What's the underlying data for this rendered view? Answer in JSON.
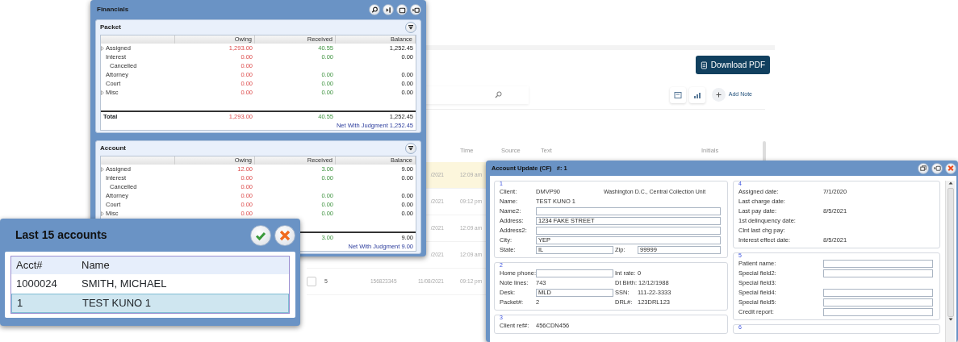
{
  "background_app": {
    "download_button": "Download PDF",
    "add_note_link": "Add Note",
    "columns": [
      "Time",
      "Source",
      "Text",
      "Initials"
    ],
    "rows": [
      {
        "selected": true,
        "date": "/2021",
        "time": "12:09 am"
      },
      {
        "selected": false,
        "date": "/2021",
        "time": "09:12 pm"
      },
      {
        "selected": false,
        "date": "/2021",
        "time": "12:09 am"
      },
      {
        "selected": false,
        "date": "/2021",
        "time": "12:09 am"
      },
      {
        "selected": false,
        "checked": false,
        "number": "5",
        "account": "156823345",
        "date": "11/08/2021",
        "time": "09:12 pm"
      }
    ]
  },
  "financials": {
    "title": "Financials",
    "panels": [
      {
        "title": "Packet",
        "columns": [
          "Owing",
          "Received",
          "Balance"
        ],
        "rows": [
          {
            "label": "Assigned",
            "expandable": true,
            "owing": "1,293.00",
            "received": "40.55",
            "balance": "1,252.45"
          },
          {
            "label": "Interest",
            "expandable": false,
            "owing": "0.00",
            "received": "0.00",
            "balance": "0.00",
            "children": [
              {
                "label": "Cancelled",
                "expandable": false,
                "owing": "0.00"
              }
            ]
          },
          {
            "label": "Attorney",
            "expandable": false,
            "owing": "0.00",
            "received": "0.00",
            "balance": "0.00"
          },
          {
            "label": "Court",
            "expandable": false,
            "owing": "0.00",
            "received": "0.00",
            "balance": "0.00"
          },
          {
            "label": "Misc",
            "expandable": true,
            "owing": "0.00",
            "received": "0.00",
            "balance": "0.00"
          }
        ],
        "total": {
          "label": "Total",
          "owing": "1,293.00",
          "received": "40.55",
          "balance": "1,252.45"
        },
        "net": "Net With Judgment 1,252.45"
      },
      {
        "title": "Account",
        "columns": [
          "Owing",
          "Received",
          "Balance"
        ],
        "rows": [
          {
            "label": "Assigned",
            "expandable": true,
            "owing": "12.00",
            "received": "3.00",
            "balance": "9.00"
          },
          {
            "label": "Interest",
            "expandable": false,
            "owing": "0.00",
            "received": "0.00",
            "balance": "0.00",
            "children": [
              {
                "label": "Cancelled",
                "expandable": false,
                "owing": "0.00"
              }
            ]
          },
          {
            "label": "Attorney",
            "expandable": false,
            "owing": "0.00",
            "received": "0.00",
            "balance": "0.00"
          },
          {
            "label": "Court",
            "expandable": false,
            "owing": "0.00",
            "received": "0.00",
            "balance": "0.00"
          },
          {
            "label": "Misc",
            "expandable": true,
            "owing": "0.00",
            "received": "0.00",
            "balance": "0.00"
          }
        ],
        "total": {
          "received": "3.00",
          "balance": "9.00"
        },
        "net": "Net With Judgment 9.00"
      }
    ]
  },
  "last_accounts": {
    "title": "Last 15 accounts",
    "columns": [
      "Acct#",
      "Name"
    ],
    "rows": [
      {
        "acct": "1000024",
        "name": "SMITH, MICHAEL",
        "selected": false
      },
      {
        "acct": "1",
        "name": "TEST KUNO 1",
        "selected": true
      }
    ]
  },
  "account_update": {
    "title": "Account Update (CF)   #: 1",
    "left_groups": [
      {
        "legend": "1",
        "rows": [
          [
            {
              "kind": "text",
              "label": "Client:",
              "value": "DMVP90"
            },
            {
              "kind": "note",
              "value": "Washington D.C., Central Collection Unit"
            }
          ],
          [
            {
              "kind": "text",
              "label": "Name:",
              "value": "TEST KUNO 1"
            }
          ],
          [
            {
              "kind": "input",
              "label": "Name2:"
            }
          ],
          [
            {
              "kind": "input",
              "label": "Address:",
              "value": "1234 FAKE STREET"
            }
          ],
          [
            {
              "kind": "input",
              "label": "Address2:"
            }
          ],
          [
            {
              "kind": "input",
              "label": "City:",
              "value": "YEP"
            }
          ],
          [
            {
              "kind": "input",
              "label": "State:",
              "value": "IL"
            },
            {
              "kind": "input",
              "label": "Zip:",
              "value": "99999"
            }
          ]
        ]
      },
      {
        "legend": "2",
        "rows": [
          [
            {
              "kind": "input",
              "label": "Home phone:"
            },
            {
              "kind": "text",
              "label": "Int rate:",
              "value": "0"
            }
          ],
          [
            {
              "kind": "text",
              "label": "Note lines:",
              "value": "743"
            },
            {
              "kind": "text",
              "label": "Dt Birth:",
              "value": "12/12/1988"
            }
          ],
          [
            {
              "kind": "input",
              "label": "Desk:",
              "value": "MLD"
            },
            {
              "kind": "text",
              "label": "SSN:",
              "value": "111-22-3333"
            }
          ],
          [
            {
              "kind": "text",
              "label": "Packet#:",
              "value": "2"
            },
            {
              "kind": "text",
              "label": "DRL#:",
              "value": "123DRL123"
            }
          ]
        ]
      },
      {
        "legend": "3",
        "rows": [
          [
            {
              "kind": "text",
              "label": "Client ref#:",
              "value": "456CDN456"
            }
          ]
        ]
      }
    ],
    "right_groups": [
      {
        "legend": "4",
        "rows": [
          [
            {
              "kind": "text",
              "label": "Assigned date:",
              "value": "7/1/2020"
            }
          ],
          [
            {
              "kind": "text",
              "label": "Last charge date:"
            }
          ],
          [
            {
              "kind": "text",
              "label": "Last pay date:",
              "value": "8/5/2021"
            }
          ],
          [
            {
              "kind": "text",
              "label": "1st delinquency date:"
            }
          ],
          [
            {
              "kind": "text",
              "label": "Clnt last chg pay:"
            }
          ],
          [
            {
              "kind": "text",
              "label": "Interest effect date:",
              "value": "8/5/2021"
            }
          ]
        ]
      },
      {
        "legend": "5",
        "rows": [
          [
            {
              "kind": "input",
              "label": "Patient name:"
            }
          ],
          [
            {
              "kind": "input",
              "label": "Special field2:"
            }
          ],
          [
            {
              "kind": "text",
              "label": "Special field3:"
            }
          ],
          [
            {
              "kind": "input",
              "label": "Special field4:"
            }
          ],
          [
            {
              "kind": "input",
              "label": "Special field5:"
            }
          ],
          [
            {
              "kind": "input",
              "label": "Credit report:"
            }
          ]
        ]
      },
      {
        "legend": "6"
      }
    ]
  }
}
